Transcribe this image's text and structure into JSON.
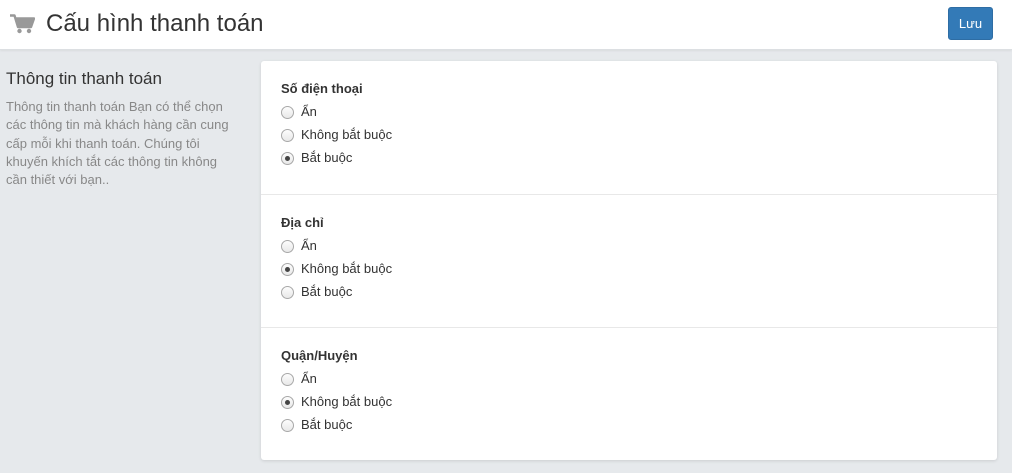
{
  "header": {
    "title": "Cấu hình thanh toán",
    "save_label": "Lưu",
    "icon": "cart-icon"
  },
  "sidebar": {
    "title": "Thông tin thanh toán",
    "description": "Thông tin thanh toán Bạn có thể chọn các thông tin mà khách hàng cần cung cấp mỗi khi thanh toán. Chúng tôi khuyến khích tắt các thông tin không cần thiết với bạn.."
  },
  "groups": [
    {
      "label": "Số điện thoại",
      "options": [
        "Ẩn",
        "Không bắt buộc",
        "Bắt buộc"
      ],
      "selected": "Bắt buộc"
    },
    {
      "label": "Địa chỉ",
      "options": [
        "Ẩn",
        "Không bắt buộc",
        "Bắt buộc"
      ],
      "selected": "Không bắt buộc"
    },
    {
      "label": "Quận/Huyện",
      "options": [
        "Ẩn",
        "Không bắt buộc",
        "Bắt buộc"
      ],
      "selected": "Không bắt buộc"
    }
  ]
}
